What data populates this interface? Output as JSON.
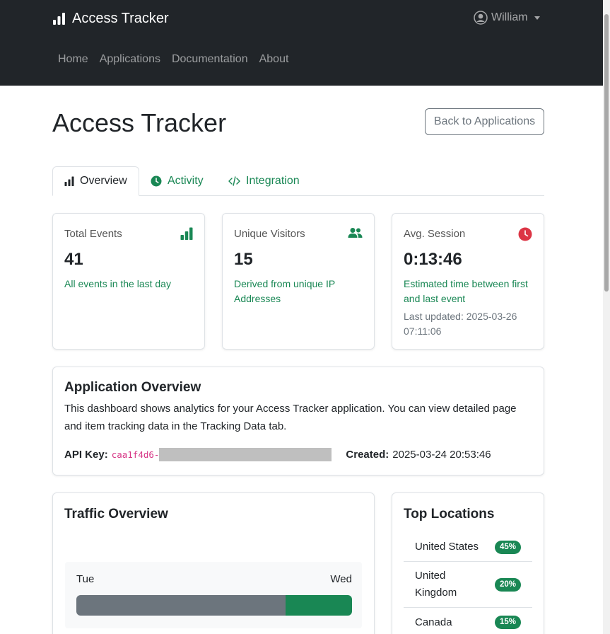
{
  "navbar": {
    "brand": "Access Tracker",
    "user": "William",
    "links": [
      "Home",
      "Applications",
      "Documentation",
      "About"
    ]
  },
  "header": {
    "title": "Access Tracker",
    "back_label": "Back to Applications"
  },
  "tabs": [
    {
      "label": "Overview",
      "icon": "bar-chart-icon"
    },
    {
      "label": "Activity",
      "icon": "clock-icon"
    },
    {
      "label": "Integration",
      "icon": "code-icon"
    }
  ],
  "stats": {
    "total": {
      "label": "Total Events",
      "value": "41",
      "desc": "All events in the last day",
      "icon": "bar-chart-icon"
    },
    "visitors": {
      "label": "Unique Visitors",
      "value": "15",
      "desc": "Derived from unique IP Addresses",
      "icon": "people-icon"
    },
    "session": {
      "label": "Avg. Session",
      "value": "0:13:46",
      "desc": "Estimated time between first and last event",
      "updated": "Last updated: 2025-03-26 07:11:06",
      "icon": "clock-icon"
    }
  },
  "overview": {
    "title": "Application Overview",
    "text": "This dashboard shows analytics for your Access Tracker application. You can view detailed page and item tracking data in the Tracking Data tab.",
    "api_label": "API Key:",
    "api_key": "caa1f4d6-",
    "created_label": "Created:",
    "created": "2025-03-24 20:53:46"
  },
  "traffic": {
    "title": "Traffic Overview"
  },
  "chart_data": {
    "type": "bar",
    "categories": [
      "Tue",
      "Wed"
    ],
    "values": [
      76,
      24
    ],
    "title": "Traffic Overview",
    "xlabel": "",
    "ylabel": ""
  },
  "locations": {
    "title": "Top Locations",
    "items": [
      {
        "name": "United States",
        "pct": "45%"
      },
      {
        "name": "United Kingdom",
        "pct": "20%"
      },
      {
        "name": "Canada",
        "pct": "15%"
      }
    ]
  },
  "colors": {
    "navbar": "#212529",
    "accent": "#198754",
    "danger": "#dc3545",
    "secondary": "#6c757d"
  }
}
